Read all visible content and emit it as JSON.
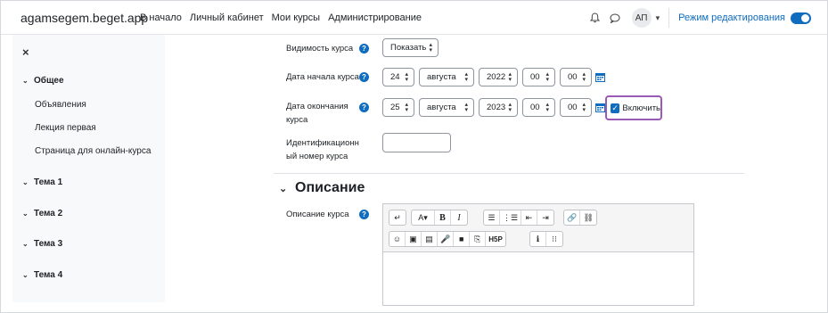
{
  "site": {
    "brand": "agamsegem.beget.app"
  },
  "nav": {
    "links": [
      "В начало",
      "Личный кабинет",
      "Мои курсы",
      "Администрирование"
    ],
    "avatar_initials": "АП",
    "edit_mode_label": "Режим редактирования",
    "edit_mode_on": true
  },
  "sidebar": {
    "close_icon": "×",
    "general": "Общее",
    "items": [
      "Объявления",
      "Лекция первая",
      "Страница для онлайн-курса"
    ],
    "topics": [
      "Тема 1",
      "Тема 2",
      "Тема 3",
      "Тема 4"
    ]
  },
  "form": {
    "visibility": {
      "label": "Видимость курса",
      "value": "Показать"
    },
    "start_date": {
      "label": "Дата начала курса",
      "day": "24",
      "month": "августа",
      "year": "2022",
      "hour": "00",
      "minute": "00"
    },
    "end_date": {
      "label_line1": "Дата окончания",
      "label_line2": "курса",
      "day": "25",
      "month": "августа",
      "year": "2023",
      "hour": "00",
      "minute": "00",
      "enable_label": "Включить",
      "enabled": true
    },
    "idnumber": {
      "label_line1": "Идентификационн",
      "label_line2": "ый номер курса",
      "value": ""
    }
  },
  "description_section": {
    "title": "Описание",
    "field_label": "Описание курса",
    "toolbar_row1": [
      "↵",
      "A▾",
      "B",
      "I",
      "☰",
      "⋮☰",
      "⇤",
      "⇥",
      "🔗",
      "⛓"
    ],
    "toolbar_row2": [
      "☺",
      "▣",
      "▤",
      "🎤",
      "■",
      "⎘",
      "H5P",
      "ℹ",
      "⁝⁝"
    ]
  },
  "colors": {
    "accent": "#0f6cbf",
    "highlight": "#9b59b6"
  }
}
